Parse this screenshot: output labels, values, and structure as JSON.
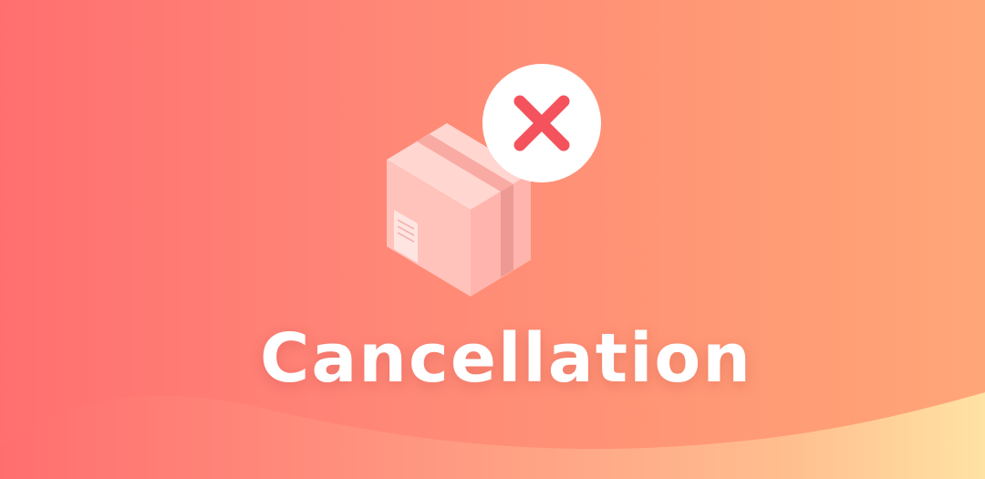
{
  "banner": {
    "title": "Cancellation",
    "icons": {
      "box": "package-box-icon",
      "badge": "cancel-x-icon"
    },
    "colors": {
      "gradient_left": "#ff6f6f",
      "gradient_right": "#ffa678",
      "x_mark": "#f4525c",
      "title": "#ffffff"
    }
  }
}
